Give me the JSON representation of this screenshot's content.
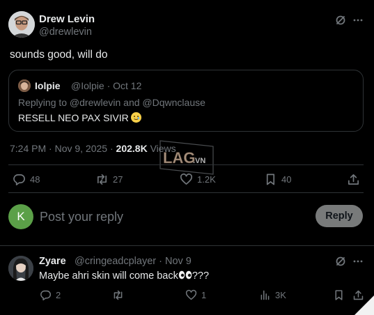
{
  "tweet": {
    "author_name": "Drew Levin",
    "author_handle": "@drewlevin",
    "text": "sounds good, will do",
    "timestamp": "7:24 PM · Nov 9, 2025 · ",
    "views_count": "202.8K",
    "views_label": " Views",
    "actions": {
      "replies": "48",
      "reposts": "27",
      "likes": "1.2K",
      "bookmarks": "40"
    }
  },
  "quote": {
    "author_name": "Iolpie",
    "author_handle": "@Iolpie · Oct 12",
    "replying_to": "Replying to @drewlevin and @Dqwnclause",
    "text": "RESELL NEO PAX SIVIR"
  },
  "composer": {
    "avatar_letter": "K",
    "placeholder": "Post your reply",
    "button_label": "Reply"
  },
  "reply": {
    "author_name": "Zyare",
    "author_handle": "@cringeadcplayer · Nov 9",
    "text": "Maybe ahri skin will come back",
    "text_suffix": "???",
    "actions": {
      "replies": "2",
      "likes": "1",
      "views": "3K"
    }
  },
  "watermark": {
    "text": "LAG",
    "suffix": ".VN"
  },
  "icons": [
    "grok-icon",
    "more-icon",
    "reply-icon",
    "repost-icon",
    "like-icon",
    "bookmark-icon",
    "share-icon",
    "views-icon"
  ],
  "colors": {
    "background": "#000000",
    "text": "#e7e9ea",
    "muted": "#71767b",
    "border": "#2f3336",
    "reply_button": "#787a7a",
    "k_avatar": "#5ba048"
  }
}
